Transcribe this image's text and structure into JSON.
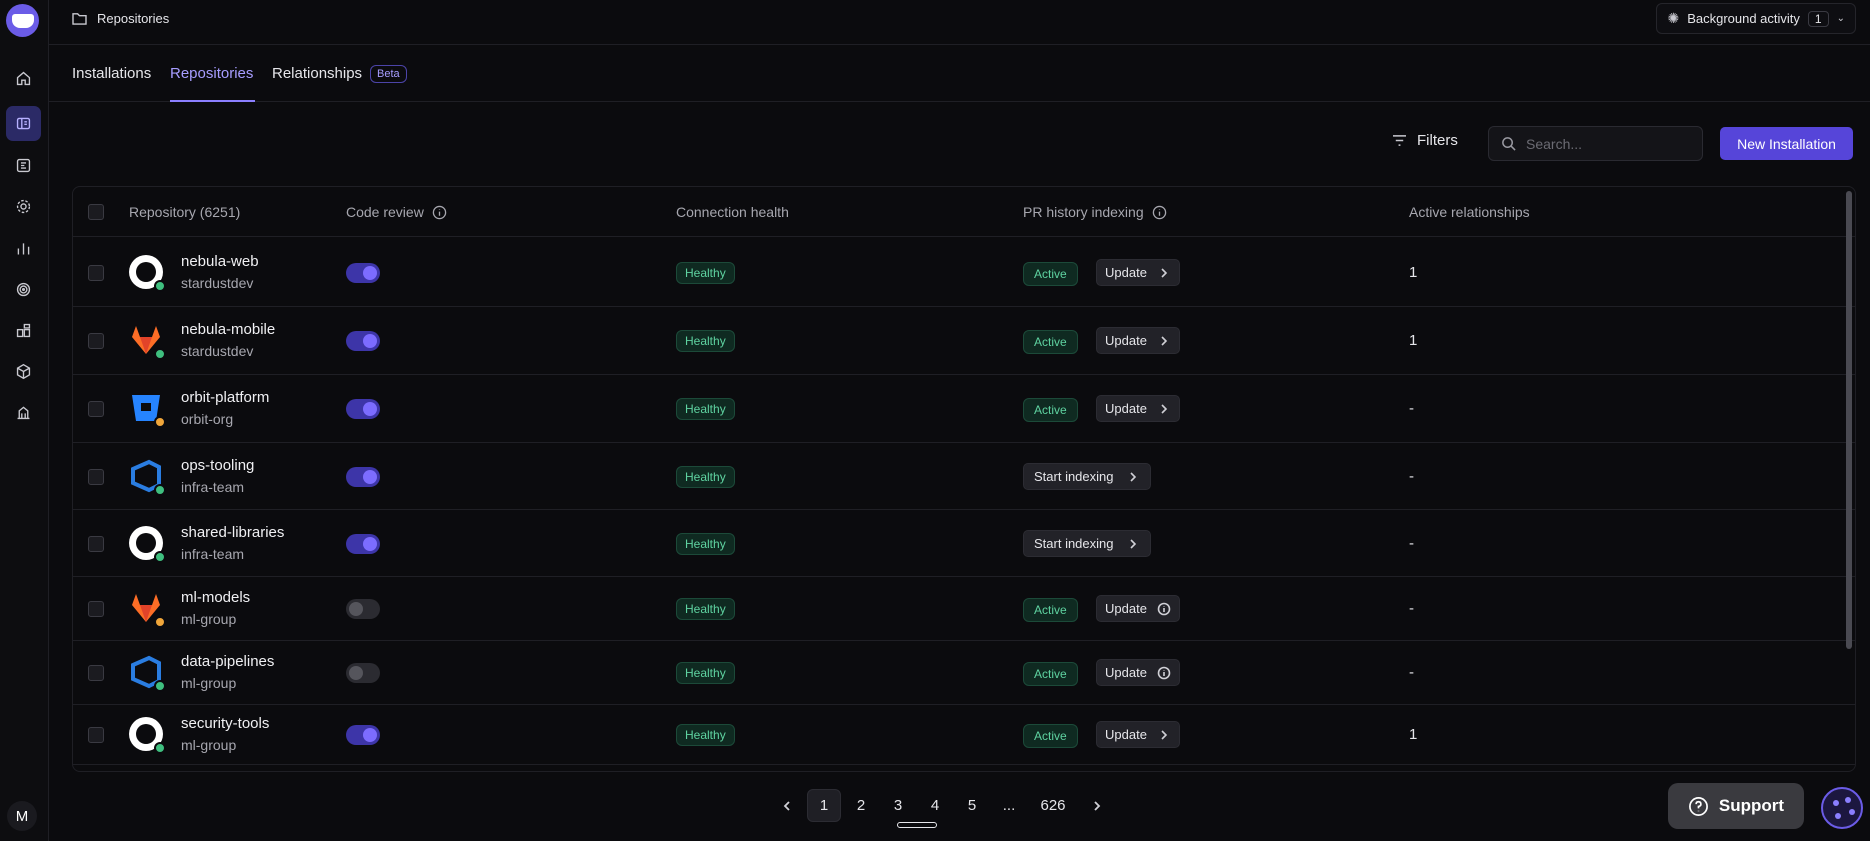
{
  "topbar": {
    "breadcrumb": "Repositories",
    "background_activity_label": "Background activity",
    "background_activity_count": "1"
  },
  "sidebar": {
    "items": [
      {
        "icon": "home-icon"
      },
      {
        "icon": "repositories-icon",
        "active": true
      },
      {
        "icon": "pull-requests-icon"
      },
      {
        "icon": "settings-icon"
      },
      {
        "icon": "analytics-icon"
      },
      {
        "icon": "target-icon"
      },
      {
        "icon": "integrations-icon"
      },
      {
        "icon": "package-icon"
      },
      {
        "icon": "organization-icon"
      }
    ],
    "user_initial": "M"
  },
  "tabs": [
    {
      "label": "Installations"
    },
    {
      "label": "Repositories",
      "active": true
    },
    {
      "label": "Relationships",
      "badge": "Beta"
    }
  ],
  "toolbar": {
    "filters_label": "Filters",
    "search_placeholder": "Search...",
    "new_installation_label": "New Installation"
  },
  "table": {
    "headers": {
      "repository": "Repository (6251)",
      "code_review": "Code review",
      "connection_health": "Connection health",
      "pr_history": "PR history indexing",
      "active_relationships": "Active relationships"
    },
    "rows": [
      {
        "name": "nebula-web",
        "org": "stardustdev",
        "provider": "github",
        "status_color": "#3fbf7f",
        "code_review": true,
        "health": "Healthy",
        "pr_status": "Active",
        "pr_action": "Update",
        "pr_action_icon": "chevron-right-icon",
        "relationships": "1"
      },
      {
        "name": "nebula-mobile",
        "org": "stardustdev",
        "provider": "gitlab",
        "status_color": "#3fbf7f",
        "code_review": true,
        "health": "Healthy",
        "pr_status": "Active",
        "pr_action": "Update",
        "pr_action_icon": "chevron-right-icon",
        "relationships": "1"
      },
      {
        "name": "orbit-platform",
        "org": "orbit-org",
        "provider": "bitbucket",
        "status_color": "#f0a63a",
        "code_review": true,
        "health": "Healthy",
        "pr_status": "Active",
        "pr_action": "Update",
        "pr_action_icon": "chevron-right-icon",
        "relationships": "-"
      },
      {
        "name": "ops-tooling",
        "org": "infra-team",
        "provider": "azure",
        "status_color": "#3fbf7f",
        "code_review": true,
        "health": "Healthy",
        "pr_status": "",
        "pr_action": "Start indexing",
        "pr_action_icon": "chevron-right-icon",
        "relationships": "-"
      },
      {
        "name": "shared-libraries",
        "org": "infra-team",
        "provider": "github",
        "status_color": "#3fbf7f",
        "code_review": true,
        "health": "Healthy",
        "pr_status": "",
        "pr_action": "Start indexing",
        "pr_action_icon": "chevron-right-icon",
        "relationships": "-"
      },
      {
        "name": "ml-models",
        "org": "ml-group",
        "provider": "gitlab",
        "status_color": "#f0a63a",
        "code_review": false,
        "health": "Healthy",
        "pr_status": "Active",
        "pr_action": "Update",
        "pr_action_icon": "info-icon",
        "relationships": "-"
      },
      {
        "name": "data-pipelines",
        "org": "ml-group",
        "provider": "azure",
        "status_color": "#3fbf7f",
        "code_review": false,
        "health": "Healthy",
        "pr_status": "Active",
        "pr_action": "Update",
        "pr_action_icon": "info-icon",
        "relationships": "-"
      },
      {
        "name": "security-tools",
        "org": "ml-group",
        "provider": "github",
        "status_color": "#3fbf7f",
        "code_review": true,
        "health": "Healthy",
        "pr_status": "Active",
        "pr_action": "Update",
        "pr_action_icon": "chevron-right-icon",
        "relationships": "1"
      }
    ]
  },
  "pagination": {
    "pages": [
      "1",
      "2",
      "3",
      "4",
      "5",
      "...",
      "626"
    ],
    "current": "1"
  },
  "support": {
    "label": "Support"
  },
  "colors": {
    "accent": "#5645d9",
    "healthy": "#5fd3a1",
    "background": "#0b0b0e"
  }
}
